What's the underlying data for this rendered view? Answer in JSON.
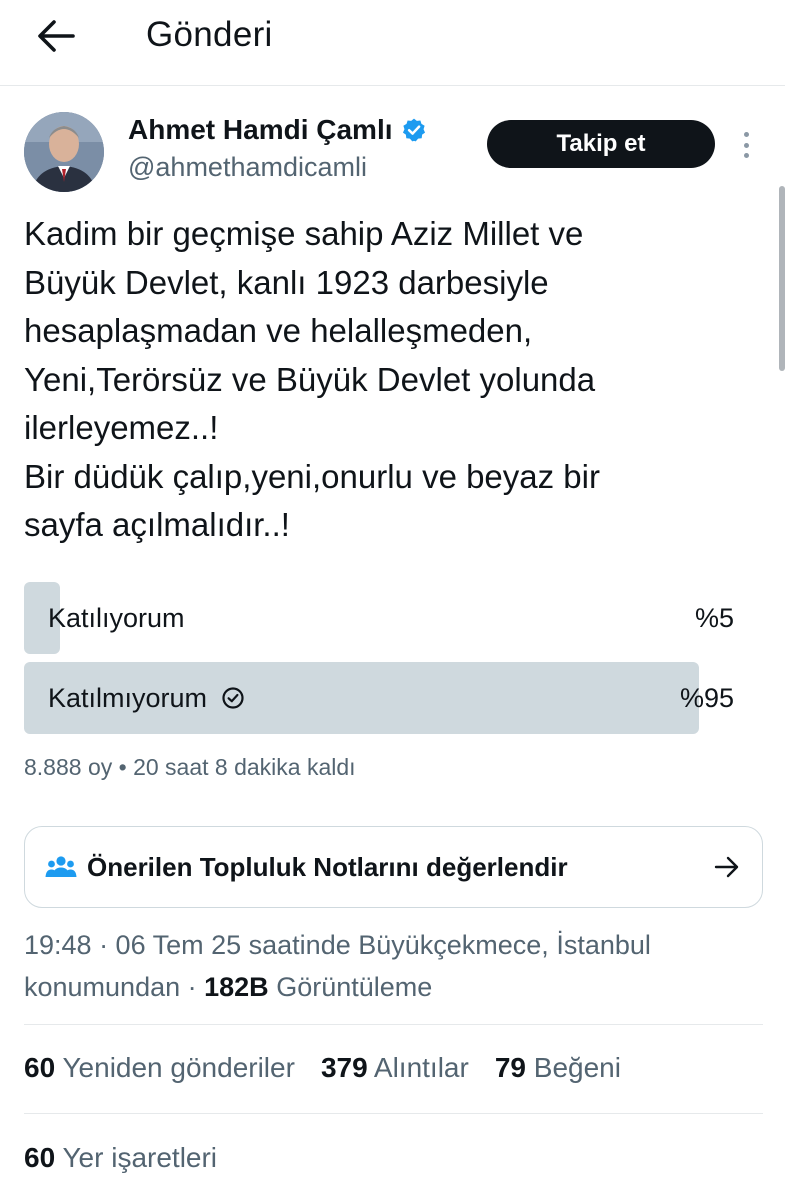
{
  "header": {
    "title": "Gönderi"
  },
  "author": {
    "name": "Ahmet Hamdi Çamlı",
    "handle": "@ahmethamdicamli",
    "verified_color": "#1d9bf0",
    "follow_label": "Takip et"
  },
  "post": {
    "text": "Kadim bir geçmişe sahip Aziz Millet  ve\nBüyük Devlet, kanlı 1923 darbesiyle\nhesaplaşmadan ve helalleşmeden,\nYeni,Terörsüz ve Büyük Devlet yolunda\nilerleyemez..!\nBir düdük çalıp,yeni,onurlu ve beyaz bir\nsayfa açılmalıdır..!"
  },
  "poll": {
    "options": [
      {
        "label": "Katılıyorum",
        "percent_text": "%5",
        "percent": 5,
        "selected": false
      },
      {
        "label": "Katılmıyorum",
        "percent_text": "%95",
        "percent": 95,
        "selected": true
      }
    ],
    "meta": "8.888 oy • 20 saat 8 dakika kaldı"
  },
  "community_notes": {
    "label": "Önerilen Topluluk Notlarını değerlendir"
  },
  "timestamp": {
    "text": "19:48 · 06 Tem 25 saatinde Büyükçekmece, İstanbul konumundan · ",
    "views_count": "182B",
    "views_label": "Görüntüleme"
  },
  "stats": {
    "reposts": {
      "count": "60",
      "label": "Yeniden gönderiler"
    },
    "quotes": {
      "count": "379",
      "label": "Alıntılar"
    },
    "likes": {
      "count": "79",
      "label": "Beğeni"
    },
    "bookmarks": {
      "count": "60",
      "label": "Yer işaretleri"
    }
  },
  "colors": {
    "text": "#0f1419",
    "secondary": "#536471",
    "poll_fill": "#cfd9de",
    "accent": "#1d9bf0"
  }
}
